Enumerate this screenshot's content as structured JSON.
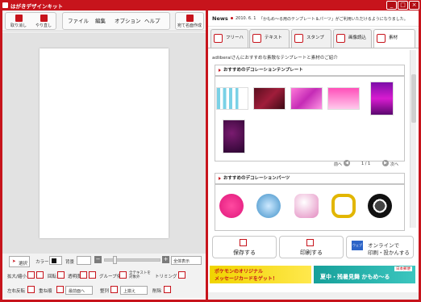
{
  "app": {
    "title": "はがきデザインキット"
  },
  "window_buttons": [
    "_",
    "□",
    "×"
  ],
  "toolbar": {
    "undo": "取り消し",
    "redo": "やり直し",
    "menus": [
      "ファイル",
      "編集",
      "オプション",
      "ヘルプ"
    ],
    "make_name": "宛て名面作成"
  },
  "news": {
    "label": "News",
    "date": "2010. 6. 1",
    "text": "「かもめ～る用のテンプレート＆パーツ」がご利用いただけるようになりました。"
  },
  "tabs": [
    {
      "label": "フリーハンド",
      "icon": "pen-icon"
    },
    {
      "label": "テキスト",
      "icon": "text-icon"
    },
    {
      "label": "スタンプ",
      "icon": "stamp-icon"
    },
    {
      "label": "画像読込",
      "icon": "image-icon"
    },
    {
      "label": "素材",
      "icon": "shapes-icon"
    }
  ],
  "content": {
    "intro": "adliberalさんにおすすめな素敵なテンプレートと素材のご紹介",
    "section1": "おすすめのデコレーションテンプレート",
    "section2": "おすすめのデコレーションパーツ",
    "pager": {
      "prev": "前へ",
      "page": "1 / 1",
      "next": "次へ"
    }
  },
  "actions": {
    "save": "保存する",
    "print": "印刷する",
    "online_line1": "オンラインで",
    "online_line2": "印刷・投かんする",
    "online_badge": "ウェブポ"
  },
  "banners": {
    "left_line1": "ポケモンのオリジナル",
    "left_line2": "メッセージカードをゲット！",
    "right_badge": "日本郵便",
    "right_text": "夏中・残暑見舞 かもめ～る"
  },
  "bottom": {
    "select": "選択",
    "color": "カラー",
    "bg": "背景",
    "show_all": "全体表示",
    "scale": "拡大/縮小",
    "rotate": "回転",
    "opacity": "透明度",
    "group": "グループ化",
    "text_object": "全テキストを対象外",
    "trimming": "トリミング",
    "flip": "左右反転",
    "layer": "重ね順",
    "front": "最前面へ",
    "align": "整列",
    "align_top": "上揃え",
    "delete": "削除"
  },
  "colors": {
    "brand": "#c7141c"
  }
}
